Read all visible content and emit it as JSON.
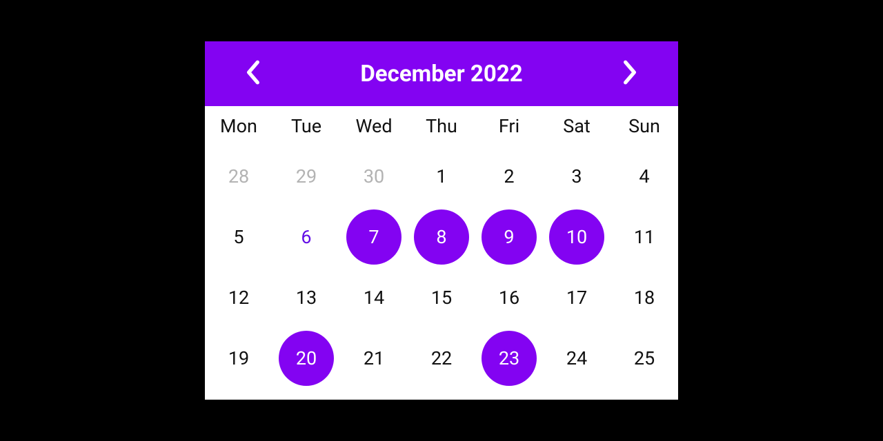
{
  "colors": {
    "accent": "#8303F2",
    "accentText": "#630EE6",
    "muted": "#B3B3B3",
    "text": "#111111",
    "background": "#FFFFFF",
    "stage": "#000000"
  },
  "header": {
    "title": "December 2022"
  },
  "weekdays": [
    "Mon",
    "Tue",
    "Wed",
    "Thu",
    "Fri",
    "Sat",
    "Sun"
  ],
  "rows": [
    [
      {
        "n": "28",
        "muted": true
      },
      {
        "n": "29",
        "muted": true
      },
      {
        "n": "30",
        "muted": true
      },
      {
        "n": "1"
      },
      {
        "n": "2"
      },
      {
        "n": "3"
      },
      {
        "n": "4"
      }
    ],
    [
      {
        "n": "5"
      },
      {
        "n": "6",
        "hlText": true
      },
      {
        "n": "7",
        "selected": true
      },
      {
        "n": "8",
        "selected": true
      },
      {
        "n": "9",
        "selected": true
      },
      {
        "n": "10",
        "selected": true
      },
      {
        "n": "11"
      }
    ],
    [
      {
        "n": "12"
      },
      {
        "n": "13"
      },
      {
        "n": "14"
      },
      {
        "n": "15"
      },
      {
        "n": "16"
      },
      {
        "n": "17"
      },
      {
        "n": "18"
      }
    ],
    [
      {
        "n": "19"
      },
      {
        "n": "20",
        "selected": true
      },
      {
        "n": "21"
      },
      {
        "n": "22"
      },
      {
        "n": "23",
        "selected": true
      },
      {
        "n": "24"
      },
      {
        "n": "25"
      }
    ]
  ]
}
